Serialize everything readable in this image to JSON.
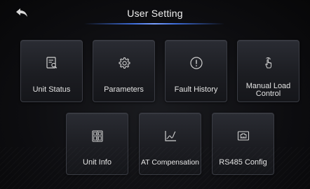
{
  "header": {
    "title": "User Setting",
    "back_icon": "back-arrow-icon"
  },
  "tiles": [
    {
      "label": "Unit Status",
      "icon": "unit-status-icon"
    },
    {
      "label": "Parameters",
      "icon": "gear-icon"
    },
    {
      "label": "Fault History",
      "icon": "alert-icon"
    },
    {
      "label": "Manual Load Control",
      "icon": "hand-touch-icon"
    },
    {
      "label": "Unit Info",
      "icon": "unit-info-icon"
    },
    {
      "label": "AT Compensation",
      "icon": "curve-chart-icon"
    },
    {
      "label": "RS485 Config",
      "icon": "port-icon"
    }
  ],
  "colors": {
    "accent": "#3c6bd8",
    "tile_border": "#3a3c44",
    "text": "#e4e4e4"
  }
}
